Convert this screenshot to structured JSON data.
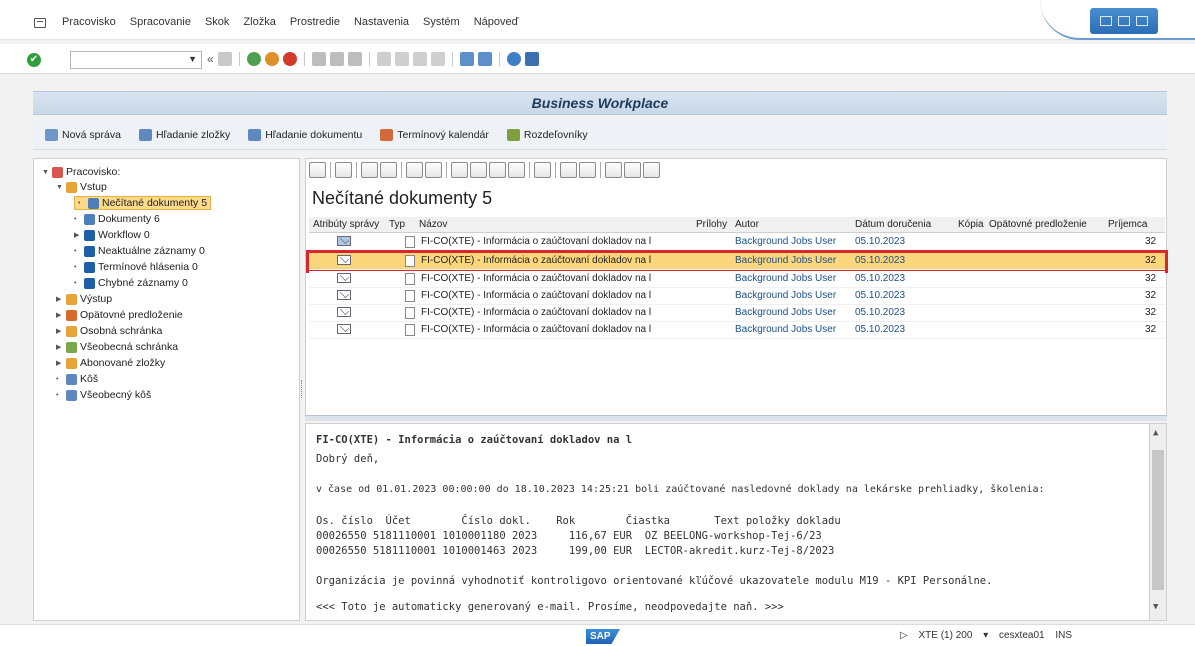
{
  "menu": [
    "Pracovisko",
    "Spracovanie",
    "Skok",
    "Zložka",
    "Prostredie",
    "Nastavenia",
    "Systém",
    "Nápoveď"
  ],
  "page_title": "Business Workplace",
  "app_toolbar": [
    {
      "label": "Nová správa",
      "icon": "new-message-icon"
    },
    {
      "label": "Hľadanie zložky",
      "icon": "binoculars-icon"
    },
    {
      "label": "Hľadanie dokumentu",
      "icon": "binoculars-icon"
    },
    {
      "label": "Termínový kalendár",
      "icon": "calendar-icon"
    },
    {
      "label": "Rozdeľovníky",
      "icon": "distribution-list-icon"
    }
  ],
  "tree": {
    "root": "Pracovisko:",
    "inbox": "Vstup",
    "inbox_items": [
      "Nečítané dokumenty 5",
      "Dokumenty 6",
      "Workflow 0",
      "Neaktuálne záznamy 0",
      "Termínové hlásenia 0",
      "Chybné záznamy 0"
    ],
    "others": [
      "Výstup",
      "Opätovné predloženie",
      "Osobná schránka",
      "Všeobecná schránka",
      "Abonované zložky",
      "Kôš",
      "Všeobecný kôš"
    ]
  },
  "grid": {
    "title": "Nečítané dokumenty 5",
    "columns": [
      "Atribúty správy",
      "Typ",
      "Názov",
      "Prílohy",
      "Autor",
      "Dátum doručenia",
      "Kópia",
      "Opätovné predloženie",
      "Príjemca"
    ],
    "rows": [
      {
        "title": "FI-CO(XTE) - Informácia o zaúčtovaní dokladov na l",
        "author": "Background Jobs User",
        "date": "05.10.2023",
        "recipient": "32"
      },
      {
        "title": "FI-CO(XTE) - Informácia o zaúčtovaní dokladov na l",
        "author": "Background Jobs User",
        "date": "05.10.2023",
        "recipient": "32"
      },
      {
        "title": "FI-CO(XTE) - Informácia o zaúčtovaní dokladov na l",
        "author": "Background Jobs User",
        "date": "05.10.2023",
        "recipient": "32"
      },
      {
        "title": "FI-CO(XTE) - Informácia o zaúčtovaní dokladov na l",
        "author": "Background Jobs User",
        "date": "05.10.2023",
        "recipient": "32"
      },
      {
        "title": "FI-CO(XTE) - Informácia o zaúčtovaní dokladov na l",
        "author": "Background Jobs User",
        "date": "05.10.2023",
        "recipient": "32"
      },
      {
        "title": "FI-CO(XTE) - Informácia o zaúčtovaní dokladov na l",
        "author": "Background Jobs User",
        "date": "05.10.2023",
        "recipient": "32"
      }
    ]
  },
  "preview": {
    "title": "FI-CO(XTE) - Informácia o zaúčtovaní dokladov na l",
    "greeting": "Dobrý deň,",
    "intro": "v čase od 01.01.2023 00:00:00 do 18.10.2023 14:25:21 boli zaúčtované nasledovné doklady na lekárske prehliadky, školenia:",
    "table_header": "Os. číslo  Účet        Číslo dokl.    Rok        Čiastka       Text položky dokladu",
    "line1": "00026550 5181110001 1010001180 2023     116,67 EUR  OZ BEELONG-workshop-Tej-6/23",
    "line2": "00026550 5181110001 1010001463 2023     199,00 EUR  LECTOR-akredit.kurz-Tej-8/2023",
    "note": "Organizácia je povinná vyhodnotiť kontroligovo orientované kľúčové ukazovatele modulu M19 - KPI Personálne.",
    "footer": "<<< Toto je automaticky generovaný e-mail. Prosíme, neodpovedajte naň. >>>"
  },
  "status": {
    "system": "XTE (1) 200",
    "server": "cesxtea01",
    "mode": "INS",
    "logo": "SAP"
  },
  "colors": {
    "selection": "#fcd67a",
    "highlight_box": "#d9252e",
    "title_bar": "#c8d8e8"
  }
}
